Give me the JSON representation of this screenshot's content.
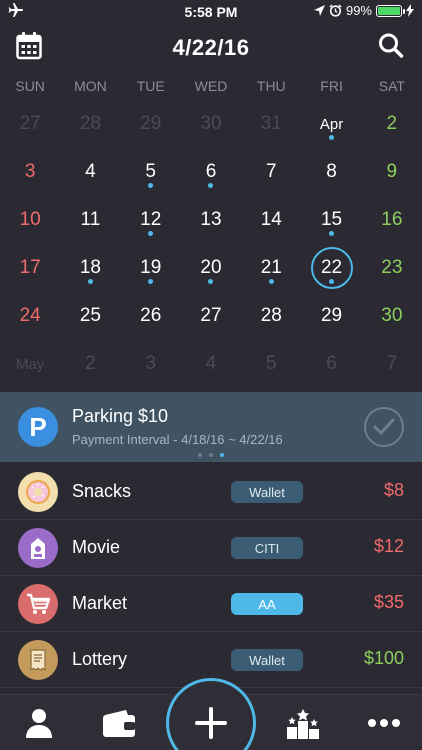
{
  "status": {
    "time": "5:58 PM",
    "battery": "99%",
    "battery_level": 0.99
  },
  "header": {
    "title": "4/22/16",
    "calendar_icon": "calendar-icon",
    "search_icon": "search-icon"
  },
  "weekdays": [
    "SUN",
    "MON",
    "TUE",
    "WED",
    "THU",
    "FRI",
    "SAT"
  ],
  "calendar": {
    "days": [
      {
        "label": "27",
        "muted": true
      },
      {
        "label": "28",
        "muted": true
      },
      {
        "label": "29",
        "muted": true
      },
      {
        "label": "30",
        "muted": true
      },
      {
        "label": "31",
        "muted": true
      },
      {
        "label": "Apr",
        "dot": true
      },
      {
        "label": "2",
        "sat": true
      },
      {
        "label": "3",
        "sun": true
      },
      {
        "label": "4"
      },
      {
        "label": "5",
        "dot": true
      },
      {
        "label": "6",
        "dot": true
      },
      {
        "label": "7"
      },
      {
        "label": "8"
      },
      {
        "label": "9",
        "sat": true
      },
      {
        "label": "10",
        "sun": true
      },
      {
        "label": "11"
      },
      {
        "label": "12",
        "dot": true
      },
      {
        "label": "13"
      },
      {
        "label": "14"
      },
      {
        "label": "15",
        "dot": true
      },
      {
        "label": "16",
        "sat": true
      },
      {
        "label": "17",
        "sun": true
      },
      {
        "label": "18",
        "dot": true
      },
      {
        "label": "19",
        "dot": true
      },
      {
        "label": "20",
        "dot": true
      },
      {
        "label": "21",
        "dot": true
      },
      {
        "label": "22",
        "dot": true,
        "today": true
      },
      {
        "label": "23",
        "sat": true
      },
      {
        "label": "24",
        "sun": true
      },
      {
        "label": "25"
      },
      {
        "label": "26"
      },
      {
        "label": "27"
      },
      {
        "label": "28"
      },
      {
        "label": "29"
      },
      {
        "label": "30",
        "sat": true
      },
      {
        "label": "May",
        "muted": true
      },
      {
        "label": "2",
        "muted": true
      },
      {
        "label": "3",
        "muted": true
      },
      {
        "label": "4",
        "muted": true
      },
      {
        "label": "5",
        "muted": true
      },
      {
        "label": "6",
        "muted": true
      },
      {
        "label": "7",
        "muted": true
      }
    ]
  },
  "event": {
    "icon_letter": "P",
    "title": "Parking $10",
    "subtitle": "Payment Interval - 4/18/16 ~ 4/22/16",
    "pages": 3,
    "active_page": 2
  },
  "transactions": [
    {
      "name": "Snacks",
      "account": "Wallet",
      "amount": "$8",
      "amount_color": "#f06b6b",
      "icon": "donut-icon",
      "icon_bg": "#f3dfae",
      "account_highlight": false
    },
    {
      "name": "Movie",
      "account": "CITI",
      "amount": "$12",
      "amount_color": "#f06b6b",
      "icon": "movie-icon",
      "icon_bg": "#9b6bc9",
      "account_highlight": false
    },
    {
      "name": "Market",
      "account": "AA",
      "amount": "$35",
      "amount_color": "#f06b6b",
      "icon": "cart-icon",
      "icon_bg": "#d96c6c",
      "account_highlight": true
    },
    {
      "name": "Lottery",
      "account": "Wallet",
      "amount": "$100",
      "amount_color": "#8cce5c",
      "icon": "receipt-icon",
      "icon_bg": "#c49b5c",
      "account_highlight": false
    }
  ],
  "tabbar": {
    "tabs": [
      "profile-icon",
      "wallet-icon",
      "add-icon",
      "ranking-icon",
      "more-icon"
    ]
  }
}
